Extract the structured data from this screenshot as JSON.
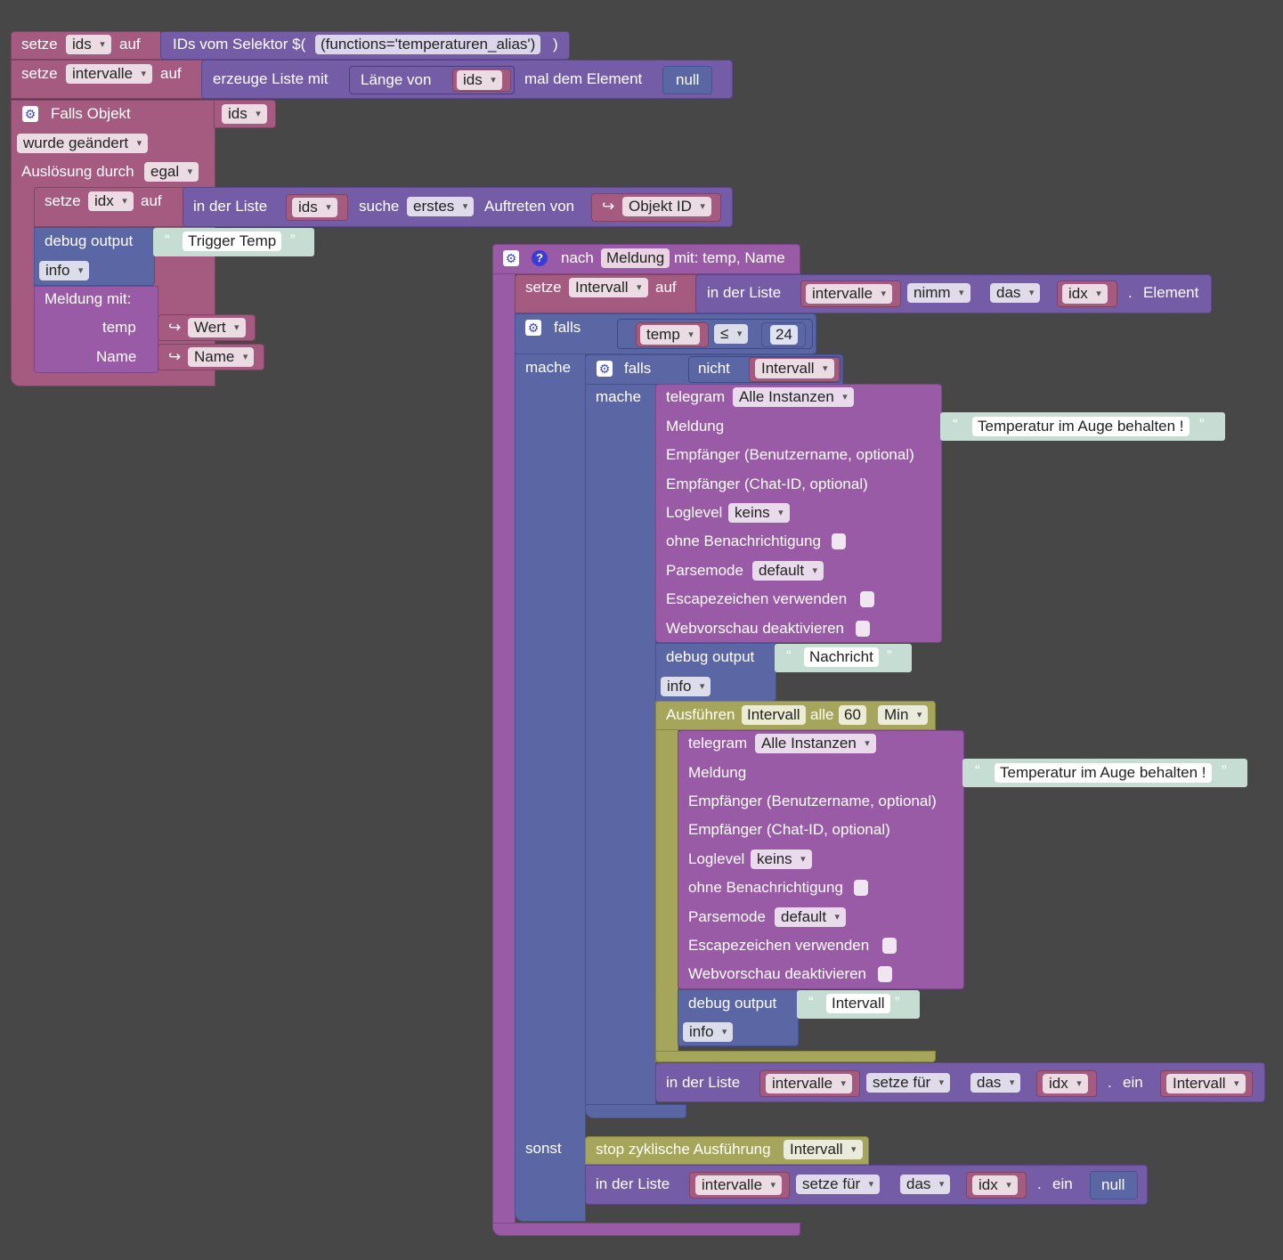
{
  "colors": {
    "background": "#474747",
    "variables": "#A55B80",
    "lists": "#745CA6",
    "logic": "#5B67A5",
    "procedure": "#995BA5",
    "timer": "#A5A55B",
    "text": "#C6DDD4"
  },
  "block1": {
    "setze": "setze",
    "var": "ids",
    "auf": "auf",
    "selector_label": "IDs vom Selektor $(",
    "selector_value": "(functions='temperaturen_alias')",
    "selector_close": ")"
  },
  "block2": {
    "setze": "setze",
    "var": "intervalle",
    "auf": "auf",
    "create": "erzeuge Liste mit",
    "length_of": "Länge von",
    "ids": "ids",
    "times": "mal dem Element",
    "null": "null"
  },
  "trigger": {
    "title": "Falls Objekt",
    "ids": "ids",
    "changed": "wurde geändert",
    "triggered_by": "Auslösung durch",
    "any": "egal",
    "set_idx": {
      "setze": "setze",
      "var": "idx",
      "auf": "auf",
      "in_list": "in der Liste",
      "ids": "ids",
      "find": "suche",
      "first": "erstes",
      "occurrence": "Auftreten von",
      "objid": "Objekt ID"
    },
    "debug": {
      "label": "debug output",
      "text": "Trigger Temp",
      "level": "info"
    },
    "message": {
      "label": "Meldung  mit:",
      "temp": "temp",
      "wert": "Wert",
      "name_label": "Name",
      "name": "Name"
    }
  },
  "procedure": {
    "after": "nach",
    "name": "Meldung",
    "params": "mit: temp, Name",
    "setze": "setze",
    "var": "Intervall",
    "auf": "auf",
    "in_list": "in der Liste",
    "list": "intervalle",
    "take": "nimm",
    "the": "das",
    "idx": "idx",
    "element": "Element",
    "if_label": "falls",
    "cond_var": "temp",
    "op": "≤",
    "threshold": "24",
    "do": "mache",
    "else": "sonst",
    "inner_if": {
      "label": "falls",
      "not": "nicht",
      "var": "Intervall",
      "do": "mache"
    }
  },
  "telegram": {
    "title": "telegram",
    "instances": "Alle Instanzen",
    "message": "Meldung",
    "message_text": "Temperatur im Auge behalten !",
    "receiver_user": "Empfänger (Benutzername, optional)",
    "receiver_chat": "Empfänger (Chat-ID, optional)",
    "loglevel": "Loglevel",
    "loglevel_value": "keins",
    "no_notify": "ohne Benachrichtigung",
    "parsemode": "Parsemode",
    "parsemode_value": "default",
    "escape": "Escapezeichen verwenden",
    "webpreview": "Webvorschau deaktivieren"
  },
  "debug2": {
    "label": "debug output",
    "text": "Nachricht",
    "level": "info"
  },
  "timer": {
    "label": "Ausführen",
    "var": "Intervall",
    "every": "alle",
    "interval": "60",
    "unit": "Min"
  },
  "debug3": {
    "label": "debug output",
    "text": "Intervall",
    "level": "info"
  },
  "setlist1": {
    "in_list": "in der Liste",
    "list": "intervalle",
    "set_for": "setze für",
    "the": "das",
    "idx": "idx",
    "dot": ".",
    "one": "ein",
    "value": "Intervall"
  },
  "stop": {
    "label": "stop zyklische Ausführung",
    "var": "Intervall"
  },
  "setlist2": {
    "in_list": "in der Liste",
    "list": "intervalle",
    "set_for": "setze für",
    "the": "das",
    "idx": "idx",
    "dot": ".",
    "one": "ein",
    "value": "null"
  }
}
